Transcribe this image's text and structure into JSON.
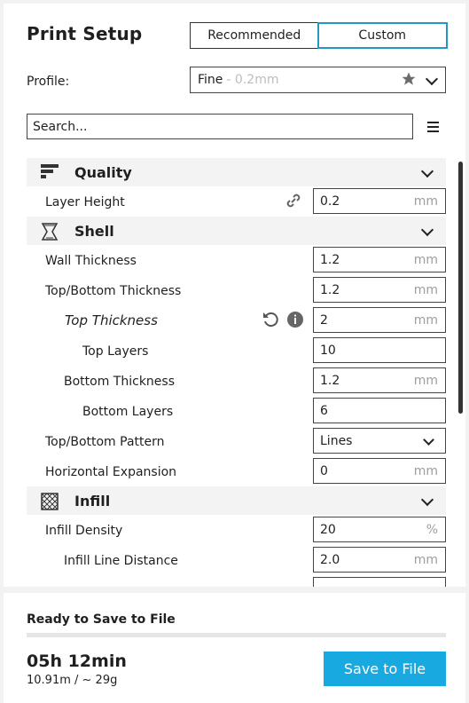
{
  "header": {
    "title": "Print Setup"
  },
  "mode_tabs": [
    {
      "label": "Recommended",
      "active": false
    },
    {
      "label": "Custom",
      "active": true
    }
  ],
  "profile": {
    "label": "Profile:",
    "value": "Fine",
    "sub": " - 0.2mm",
    "favorite_icon": "star-icon"
  },
  "search": {
    "placeholder": "Search..."
  },
  "sections": {
    "quality": {
      "label": "Quality",
      "icon": "quality-icon"
    },
    "shell": {
      "label": "Shell",
      "icon": "shell-icon"
    },
    "infill": {
      "label": "Infill",
      "icon": "infill-icon"
    }
  },
  "rows": {
    "layer_height": {
      "label": "Layer Height",
      "value": "0.2",
      "unit": "mm"
    },
    "wall_thickness": {
      "label": "Wall Thickness",
      "value": "1.2",
      "unit": "mm"
    },
    "topbottom_thickness": {
      "label": "Top/Bottom Thickness",
      "value": "1.2",
      "unit": "mm"
    },
    "top_thickness": {
      "label": "Top Thickness",
      "value": "2",
      "unit": "mm"
    },
    "top_layers": {
      "label": "Top Layers",
      "value": "10"
    },
    "bottom_thickness": {
      "label": "Bottom Thickness",
      "value": "1.2",
      "unit": "mm"
    },
    "bottom_layers": {
      "label": "Bottom Layers",
      "value": "6"
    },
    "topbottom_pattern": {
      "label": "Top/Bottom Pattern",
      "value": "Lines"
    },
    "horizontal_expansion": {
      "label": "Horizontal Expansion",
      "value": "0",
      "unit": "mm"
    },
    "infill_density": {
      "label": "Infill Density",
      "value": "20",
      "unit": "%"
    },
    "infill_line_distance": {
      "label": "Infill Line Distance",
      "value": "2.0",
      "unit": "mm"
    }
  },
  "output": {
    "status": "Ready to Save to File",
    "progress": 0,
    "time": "05h 12min",
    "material": "10.91m / ~ 29g",
    "save_label": "Save to File"
  },
  "colors": {
    "accent": "#19a9e1",
    "tab_border": "#2597c7"
  }
}
